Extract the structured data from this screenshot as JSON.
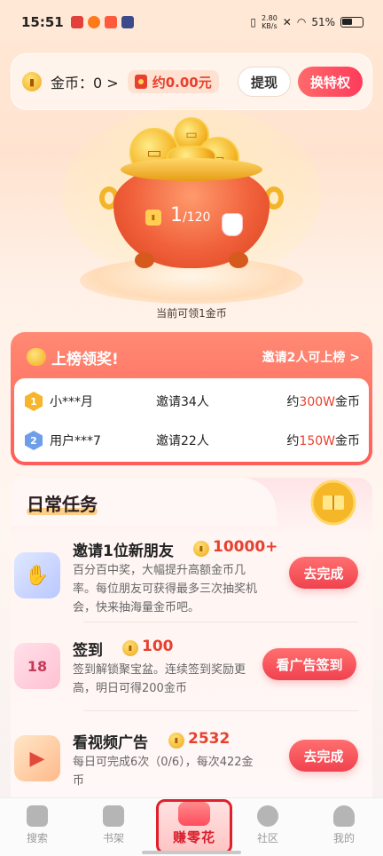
{
  "status_bar": {
    "time": "15:51",
    "net_speed": "2.80",
    "net_unit": "KB/s",
    "battery": "51%"
  },
  "coin_bar": {
    "coins_label": "金币：0 >",
    "money": "约0.00元",
    "withdraw": "提现",
    "privilege": "换特权"
  },
  "pot": {
    "count": "1",
    "total": "/120",
    "hint": "当前可领1金币"
  },
  "rank": {
    "title": "上榜领奖!",
    "link": "邀请2人可上榜 >",
    "rows": [
      {
        "place": "1",
        "name": "小***月",
        "invite": "邀请34人",
        "reward_prefix": "约",
        "reward_value": "300W",
        "reward_suffix": "金币"
      },
      {
        "place": "2",
        "name": "用户***7",
        "invite": "邀请22人",
        "reward_prefix": "约",
        "reward_value": "150W",
        "reward_suffix": "金币"
      }
    ]
  },
  "tasks": {
    "title": "日常任务",
    "items": [
      {
        "name": "邀请1位新朋友",
        "reward": "10000+",
        "desc": "百分百中奖，大幅提升高额金币几率。每位朋友可获得最多三次抽奖机会，快来抽海量金币吧。",
        "button": "去完成"
      },
      {
        "name": "签到",
        "reward": "100",
        "desc": "签到解锁聚宝盆。连续签到奖励更高，明日可得200金币",
        "button": "看广告签到"
      },
      {
        "name": "看视频广告",
        "reward": "2532",
        "desc": "每日可完成6次（0/6），每次422金币",
        "button": "去完成"
      }
    ]
  },
  "tabbar": {
    "search": "搜索",
    "shelf": "书架",
    "earn": "赚零花",
    "community": "社区",
    "mine": "我的"
  },
  "colors": {
    "accent_red": "#f0424f",
    "reward_red": "#e8402f",
    "gold": "#f5b627"
  }
}
